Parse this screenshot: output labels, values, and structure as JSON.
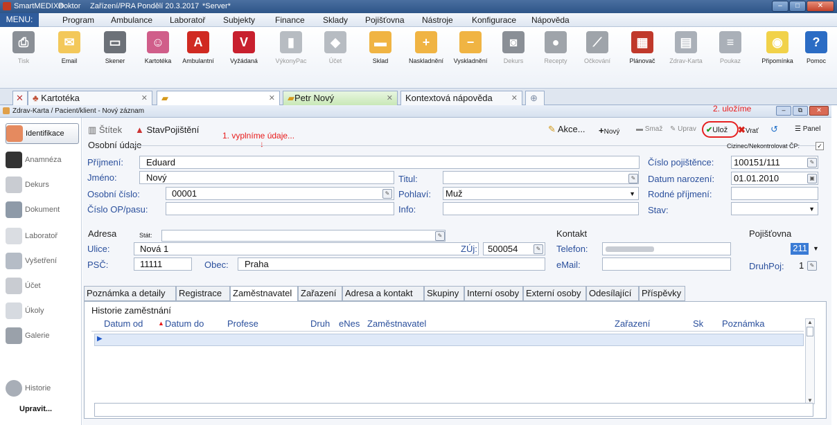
{
  "titlebar": {
    "app": "SmartMEDIX®",
    "user": "Doktor",
    "place": "Zařízení/PRA",
    "date": "Pondělí 20.3.2017",
    "server": "*Server*"
  },
  "menu": [
    "MENU:",
    "Program",
    "Ambulance",
    "Laboratoř",
    "Subjekty",
    "Finance",
    "Sklady",
    "Pojišťovna",
    "Nástroje",
    "Konfigurace",
    "Nápověda"
  ],
  "toolbar": [
    {
      "label": "Tisk",
      "icon": "printer-icon",
      "dis": true
    },
    {
      "label": "Email",
      "icon": "email-icon"
    },
    {
      "label": "Skener",
      "icon": "scanner-icon"
    },
    {
      "label": "Kartotéka",
      "icon": "people-icon"
    },
    {
      "label": "Ambulantní",
      "icon": "a-icon"
    },
    {
      "label": "Vyžádaná",
      "icon": "v-icon"
    },
    {
      "label": "VýkonyPac",
      "icon": "chart-icon",
      "dis": true
    },
    {
      "label": "Účet",
      "icon": "diamond-icon",
      "dis": true
    },
    {
      "label": "Sklad",
      "icon": "box-icon"
    },
    {
      "label": "Naskladnění",
      "icon": "box-plus-icon"
    },
    {
      "label": "Vyskladnění",
      "icon": "box-minus-icon"
    },
    {
      "label": "Dekurs",
      "icon": "camera-icon",
      "dis": true
    },
    {
      "label": "Recepty",
      "icon": "pill-icon",
      "dis": true
    },
    {
      "label": "Očkování",
      "icon": "syringe-icon",
      "dis": true
    },
    {
      "label": "Plánovač",
      "icon": "calendar-icon"
    },
    {
      "label": "Zdrav-Karta",
      "icon": "card-icon",
      "dis": true
    },
    {
      "label": "Poukaz",
      "icon": "document-icon",
      "dis": true
    },
    {
      "label": "Připomínka",
      "icon": "bulb-icon"
    },
    {
      "label": "Pomoc",
      "icon": "help-icon"
    }
  ],
  "doctabs": {
    "kartoteka": "Kartotéka",
    "patient": "Petr Nový",
    "help": "Kontextová nápověda"
  },
  "subtitle": "Zdrav-Karta / Pacient/klient - Nový záznam",
  "sidebar": [
    "Identifikace",
    "Anamnéza",
    "Dekurs",
    "Dokument",
    "Laboratoř",
    "Vyšetření",
    "Účet",
    "Úkoly",
    "Galerie",
    "Historie",
    "Upravit..."
  ],
  "actionbar": {
    "stitek": "Štítek",
    "stav": "StavPojištění",
    "akce": "Akce...",
    "novy": "Nový",
    "smaz": "Smaž",
    "uprav": "Uprav",
    "uloz": "Ulož",
    "vrat": "Vrať",
    "panel": "Panel"
  },
  "annotations": {
    "step1": "1. vyplníme údaje...",
    "step2": "2. uložíme"
  },
  "osobni": {
    "title": "Osobní údaje",
    "cizinec": "Cizinec/Nekontrolovat ČP:",
    "prijmeni_l": "Příjmení:",
    "prijmeni": "Eduard",
    "jmeno_l": "Jméno:",
    "jmeno": "Nový",
    "titul_l": "Titul:",
    "oc_l": "Osobní číslo:",
    "oc": "00001",
    "pohlavi_l": "Pohlaví:",
    "pohlavi": "Muž",
    "op_l": "Číslo OP/pasu:",
    "info_l": "Info:",
    "cp_l": "Číslo pojištěnce:",
    "cp": "100151/111",
    "dn_l": "Datum narození:",
    "dn": "01.01.2010",
    "rp_l": "Rodné příjmení:",
    "stav_l": "Stav:"
  },
  "adresa": {
    "title": "Adresa",
    "stat_l": "Stát:",
    "ulice_l": "Ulice:",
    "ulice": "Nová 1",
    "zuj_l": "ZÚj:",
    "zuj": "500054",
    "psc_l": "PSČ:",
    "psc": "11111",
    "obec_l": "Obec:",
    "obec": "Praha"
  },
  "kontakt": {
    "title": "Kontakt",
    "tel_l": "Telefon:",
    "email_l": "eMail:"
  },
  "pojistovna": {
    "title": "Pojišťovna",
    "kod": "211",
    "druh_l": "DruhPoj:",
    "druh": "1"
  },
  "tabs": [
    "Poznámka a detaily",
    "Registrace",
    "Zaměstnavatel",
    "Zařazení",
    "Adresa a kontakt",
    "Skupiny",
    "Interní osoby",
    "Externí osoby",
    "Odesílající",
    "Příspěvky"
  ],
  "grid": {
    "title": "Historie zaměstnání",
    "cols": [
      "Datum od",
      "Datum do",
      "Profese",
      "Druh",
      "eNes",
      "Zaměstnavatel",
      "Zařazení",
      "Sk",
      "Poznámka"
    ]
  }
}
